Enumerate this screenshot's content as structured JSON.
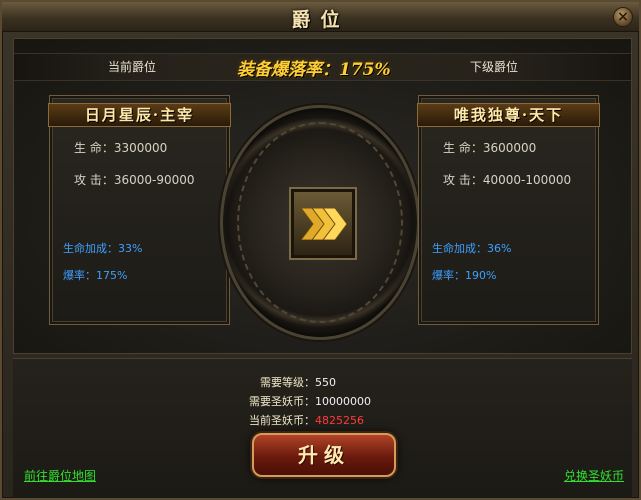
{
  "window": {
    "title": "爵位",
    "close_label": "×"
  },
  "header": {
    "current_rank_label": "当前爵位",
    "next_rank_label": "下级爵位",
    "drop_rate_text": "装备爆落率：175%"
  },
  "current_rank": {
    "name": "日月星辰·主宰",
    "hp_label": "生  命：",
    "hp_value": "3300000",
    "atk_label": "攻  击：",
    "atk_value": "36000-90000",
    "hp_bonus_label": "生命加成：",
    "hp_bonus_value": "33%",
    "burst_label": "爆率：",
    "burst_value": "175%"
  },
  "next_rank": {
    "name": "唯我独尊·天下",
    "hp_label": "生  命：",
    "hp_value": "3600000",
    "atk_label": "攻  击：",
    "atk_value": "40000-100000",
    "hp_bonus_label": "生命加成：",
    "hp_bonus_value": "36%",
    "burst_label": "爆率：",
    "burst_value": "190%"
  },
  "requirements": {
    "level_label": "需要等级：",
    "level_value": "550",
    "coin_label": "需要圣妖币：",
    "coin_value": "10000000",
    "current_coin_label": "当前圣妖币：",
    "current_coin_value": "4825256"
  },
  "actions": {
    "upgrade_label": "升级",
    "goto_map_link": "前往爵位地图",
    "exchange_link": "兑换圣妖币"
  },
  "colors": {
    "accent_gold": "#ffcf36",
    "stat_blue": "#3ea0ff",
    "link_green": "#2fe02f",
    "value_red": "#ff3b3b"
  },
  "icons": {
    "center": "arrow-right-chevrons-icon",
    "close": "close-icon"
  }
}
